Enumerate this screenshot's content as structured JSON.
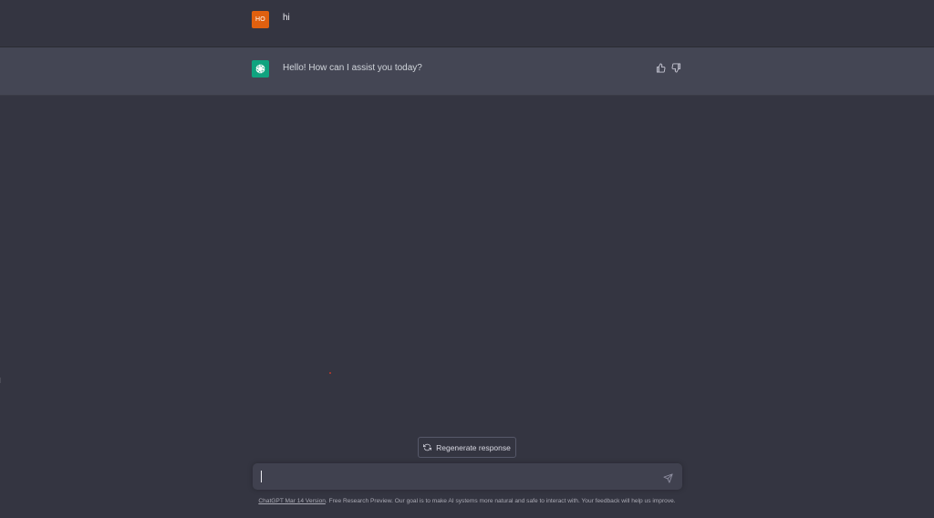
{
  "conversation": {
    "user_message": {
      "avatar_initials": "HO",
      "avatar_color": "#e0600f",
      "text": "hi"
    },
    "assistant_message": {
      "avatar_icon": "openai-logo-icon",
      "avatar_color": "#10a37f",
      "text": "Hello! How can I assist you today?",
      "thumbs_up_icon": "thumbs-up-icon",
      "thumbs_down_icon": "thumbs-down-icon"
    }
  },
  "regenerate": {
    "label": "Regenerate response",
    "icon": "refresh-icon"
  },
  "composer": {
    "value": "",
    "send_icon": "send-icon"
  },
  "footer": {
    "version_link": "ChatGPT Mar 14 Version",
    "text": ". Free Research Preview. Our goal is to make AI systems more natural and safe to interact with. Your feedback will help us improve."
  },
  "colors": {
    "background": "#343541",
    "assistant_row": "#444654",
    "composer": "#40414f"
  }
}
